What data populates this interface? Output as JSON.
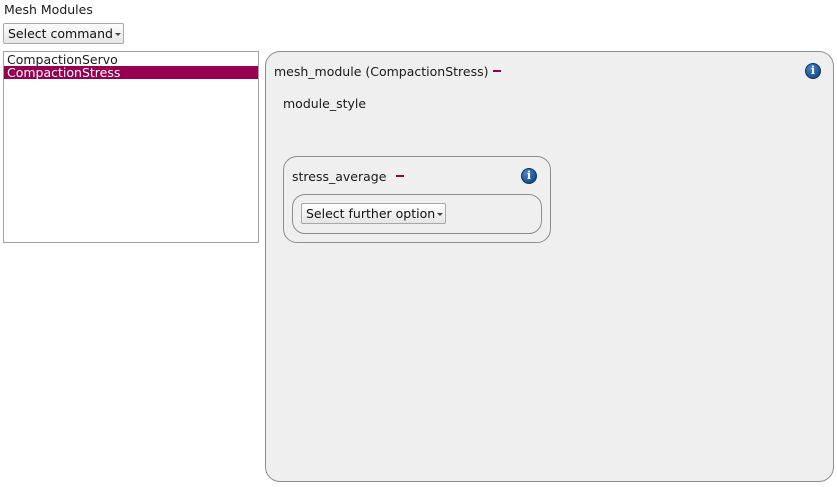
{
  "page": {
    "title": "Mesh Modules"
  },
  "command_select": {
    "label": "Select command"
  },
  "module_list": {
    "items": [
      {
        "label": "CompactionServo",
        "selected": false
      },
      {
        "label": "CompactionStress",
        "selected": true
      }
    ]
  },
  "panel": {
    "title": "mesh_module (CompactionStress)",
    "sub_label": "module_style",
    "group": {
      "title": "stress_average",
      "option_select_label": "Select further option"
    }
  },
  "icons": {
    "remove": "minus-icon",
    "info": "info-icon",
    "dropdown": "chevron-down-icon"
  },
  "colors": {
    "selection": "#970050",
    "remove_icon": "#970050",
    "info_icon": "#174c8c",
    "panel_background": "#efefef"
  }
}
